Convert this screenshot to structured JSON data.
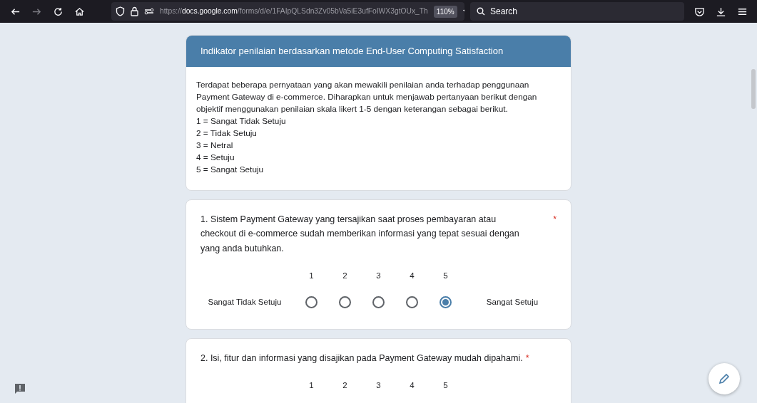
{
  "browser": {
    "url": "https://**docs.google.com**/forms/d/e/1FAIpQLSdn3Zv05bVa5iE3ufFoIWX3gtOUx_Th",
    "zoom": "110%",
    "search": {
      "placeholder": "Search"
    }
  },
  "section": {
    "title": "Indikator penilaian berdasarkan metode End-User Computing Satisfaction",
    "description": [
      "Terdapat beberapa pernyataan yang akan mewakili penilaian anda terhadap penggunaan Payment Gateway di e-commerce. Diharapkan untuk menjawab pertanyaan berikut dengan objektif menggunakan penilaian skala likert 1-5 dengan keterangan sebagai berikut.",
      "1 = Sangat Tidak Setuju",
      "2 = Tidak Setuju",
      "3 = Netral",
      "4 = Setuju",
      "5 = Sangat Setuju"
    ]
  },
  "questions": [
    {
      "text": "1. Sistem Payment Gateway yang tersajikan saat proses pembayaran atau checkout di e-commerce sudah memberikan informasi yang tepat sesuai dengan yang anda butuhkan.",
      "required_mark": "*",
      "low_label": "Sangat Tidak Setuju",
      "high_label": "Sangat Setuju",
      "options": [
        {
          "label": "1",
          "selected": false
        },
        {
          "label": "2",
          "selected": false
        },
        {
          "label": "3",
          "selected": false
        },
        {
          "label": "4",
          "selected": false
        },
        {
          "label": "5",
          "selected": true
        }
      ]
    },
    {
      "text": "2. Isi, fitur dan informasi yang disajikan pada Payment Gateway mudah dipahami.",
      "required_mark": "*",
      "options": [
        {
          "label": "1"
        },
        {
          "label": "2"
        },
        {
          "label": "3"
        },
        {
          "label": "4"
        },
        {
          "label": "5"
        }
      ]
    }
  ]
}
